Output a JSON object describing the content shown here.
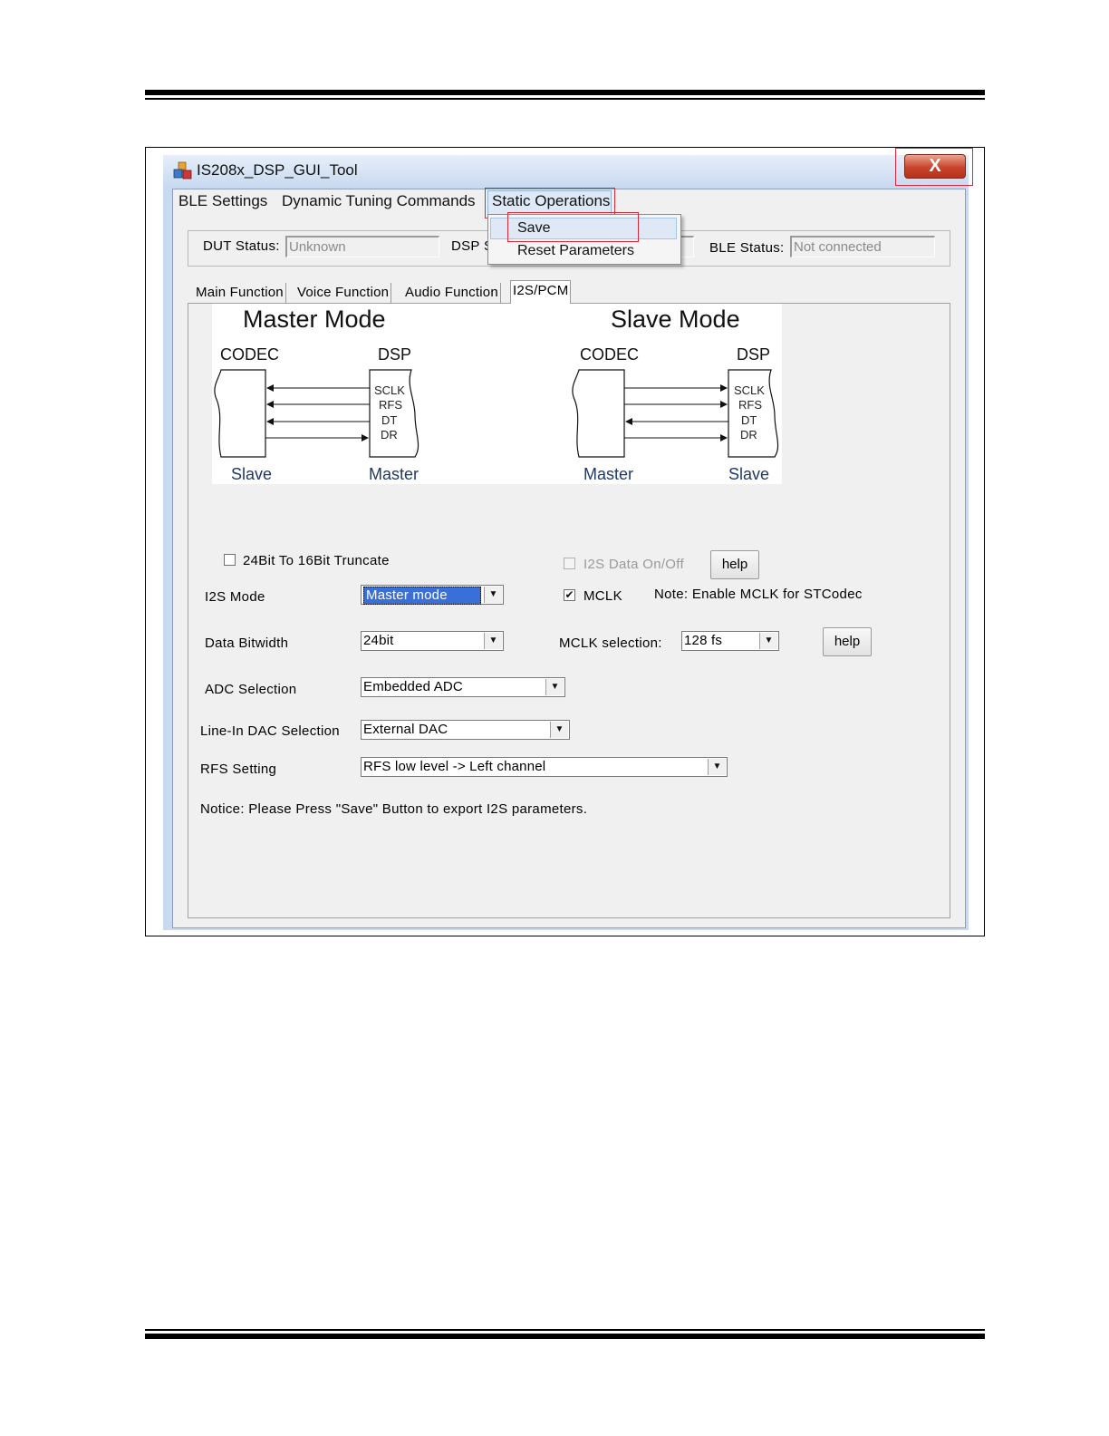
{
  "window": {
    "title": "IS208x_DSP_GUI_Tool",
    "close_label": "X"
  },
  "menu": {
    "items": [
      "BLE Settings",
      "Dynamic Tuning Commands",
      "Static Operations"
    ],
    "dropdown": [
      "Save",
      "Reset Parameters"
    ]
  },
  "status": {
    "dut_label": "DUT Status:",
    "dut_value": "Unknown",
    "dsp_label": "DSP S",
    "ble_label": "BLE Status:",
    "ble_value": "Not connected"
  },
  "tabs": [
    "Main Function",
    "Voice Function",
    "Audio Function",
    "I2S/PCM"
  ],
  "active_tab": "I2S/PCM",
  "diagram": {
    "master": {
      "title": "Master Mode",
      "codec": "CODEC",
      "dsp": "DSP",
      "codec_role": "Slave",
      "dsp_role": "Master"
    },
    "slave": {
      "title": "Slave Mode",
      "codec": "CODEC",
      "dsp": "DSP",
      "codec_role": "Master",
      "dsp_role": "Slave"
    },
    "signals": [
      "SCLK",
      "RFS",
      "DT",
      "DR"
    ]
  },
  "form": {
    "truncate_label": "24Bit To 16Bit Truncate",
    "truncate_checked": false,
    "i2s_data_label": "I2S Data On/Off",
    "i2s_data_checked": false,
    "help1": "help",
    "i2s_mode_label": "I2S Mode",
    "i2s_mode_value": "Master mode",
    "mclk_label": "MCLK",
    "mclk_checked": true,
    "mclk_note": "Note: Enable MCLK for STCodec",
    "bitwidth_label": "Data Bitwidth",
    "bitwidth_value": "24bit",
    "mclk_sel_label": "MCLK selection:",
    "mclk_sel_value": "128 fs",
    "help2": "help",
    "adc_label": "ADC Selection",
    "adc_value": "Embedded ADC",
    "dac_label": "Line-In DAC Selection",
    "dac_value": "External DAC",
    "rfs_label": "RFS Setting",
    "rfs_value": "RFS low level -> Left channel",
    "notice": "Notice:  Please Press \"Save\" Button to export I2S parameters."
  },
  "colors": {
    "highlight_box": "#d8283b",
    "close_button": "#c7442b",
    "selection": "#3a6fd8",
    "role_label": "#1f3864"
  }
}
